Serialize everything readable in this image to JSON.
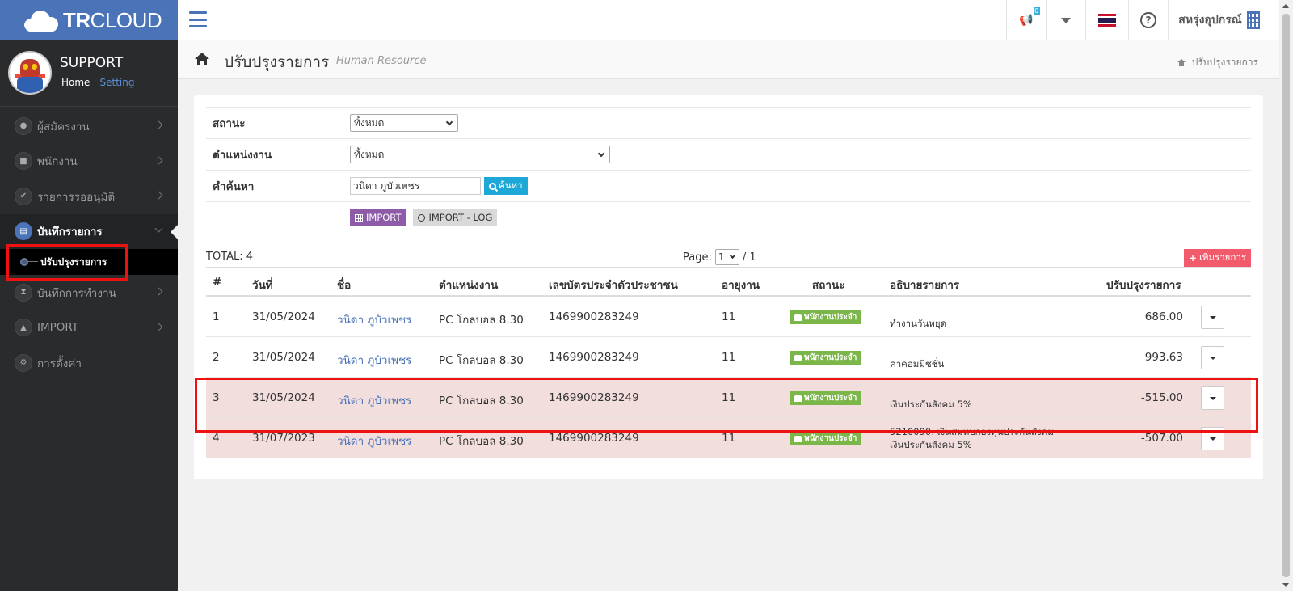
{
  "brand": {
    "bold": "TR",
    "light": "CLOUD"
  },
  "header": {
    "notification_count": "0",
    "company": "สหรุ่งอุปกรณ์"
  },
  "profile": {
    "name": "SUPPORT",
    "home": "Home",
    "sep": "|",
    "setting": "Setting"
  },
  "sidebar": {
    "items": [
      {
        "label": "ผู้สมัครงาน",
        "icon": "user-icon"
      },
      {
        "label": "พนักงาน",
        "icon": "lock-icon"
      },
      {
        "label": "รายการรออนุมัติ",
        "icon": "check-icon"
      },
      {
        "label": "บันทึกรายการ",
        "icon": "file-icon"
      },
      {
        "label": "บันทึกการทำงาน",
        "icon": "hourglass-icon"
      },
      {
        "label": "IMPORT",
        "icon": "upload-icon"
      },
      {
        "label": "การตั้งค่า",
        "icon": "cogs-icon"
      }
    ],
    "submenu_label": "ปรับปรุงรายการ"
  },
  "page": {
    "title": "ปรับปรุงรายการ",
    "subtitle": "Human Resource",
    "breadcrumb": "ปรับปรุงรายการ"
  },
  "filters": {
    "status_label": "สถานะ",
    "status_value": "ทั้งหมด",
    "position_label": "ตำแหน่งงาน",
    "position_value": "ทั้งหมด",
    "search_label": "คำค้นหา",
    "search_value": "วนิดา ภูบัวเพชร",
    "search_button": "ค้นหา",
    "import_button": "IMPORT",
    "import_log_button": "IMPORT - LOG"
  },
  "summary": {
    "total": "TOTAL: 4",
    "page_label": "Page:",
    "page_value": "1",
    "page_total": "/ 1",
    "add_button": "เพิ่มรายการ"
  },
  "table": {
    "headers": [
      "#",
      "วันที่",
      "ชื่อ",
      "ตำแหน่งงาน",
      "เลขบัตรประจำตัวประชาชน",
      "อายุงาน",
      "สถานะ",
      "อธิบายรายการ",
      "ปรับปรุงรายการ"
    ],
    "rows": [
      {
        "no": "1",
        "date": "31/05/2024",
        "name": "วนิดา ภูบัวเพชร",
        "position": "PC โกลบอล 8.30",
        "id_card": "1469900283249",
        "tenure": "11",
        "status": "พนักงานประจำ",
        "desc1": "",
        "desc2": "ทำงานวันหยุด",
        "amount": "686.00"
      },
      {
        "no": "2",
        "date": "31/05/2024",
        "name": "วนิดา ภูบัวเพชร",
        "position": "PC โกลบอล 8.30",
        "id_card": "1469900283249",
        "tenure": "11",
        "status": "พนักงานประจำ",
        "desc1": "",
        "desc2": "ค่าคอมมิชชั่น",
        "amount": "993.63"
      },
      {
        "no": "3",
        "date": "31/05/2024",
        "name": "วนิดา ภูบัวเพชร",
        "position": "PC โกลบอล 8.30",
        "id_card": "1469900283249",
        "tenure": "11",
        "status": "พนักงานประจำ",
        "desc1": "",
        "desc2": "เงินประกันสังคม 5%",
        "amount": "-515.00"
      },
      {
        "no": "4",
        "date": "31/07/2023",
        "name": "วนิดา ภูบัวเพชร",
        "position": "PC โกลบอล 8.30",
        "id_card": "1469900283249",
        "tenure": "11",
        "status": "พนักงานประจำ",
        "desc1": "5210090: เงินสมทบกองทุนประกันสังคม",
        "desc2": "เงินประกันสังคม 5%",
        "amount": "-507.00"
      }
    ]
  },
  "colors": {
    "brand": "#4a73b8",
    "sidebar": "#2a2b2d",
    "status_green": "#7ab648",
    "highlight": "#ee1111",
    "add_button": "#f25b6b"
  }
}
